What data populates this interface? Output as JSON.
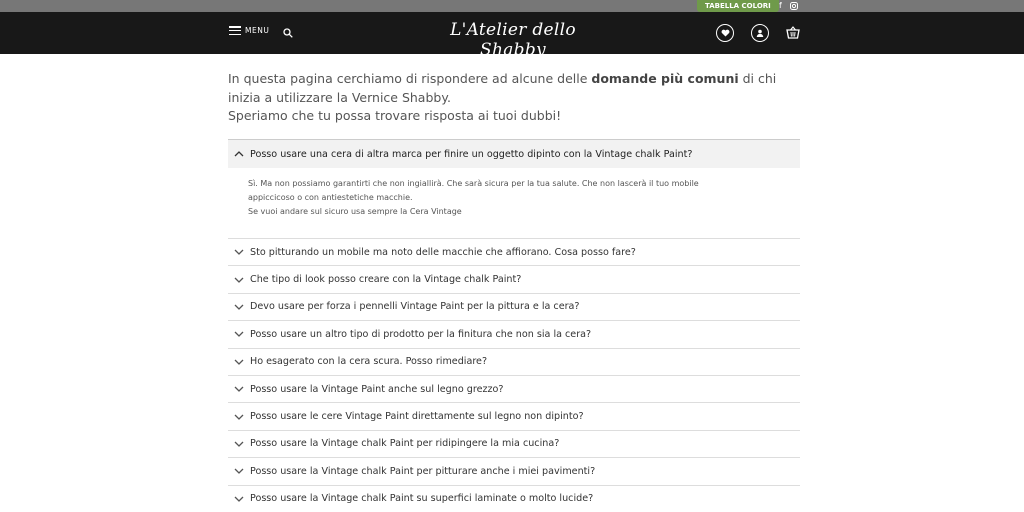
{
  "topbar": {
    "tabella_label": "TABELLA COLORI",
    "facebook_icon": "f"
  },
  "header": {
    "menu_label": "MENU",
    "logo_text": "L'Atelier dello Shabby"
  },
  "intro": {
    "part1": "In questa pagina cerchiamo di rispondere ad alcune delle ",
    "bold": "domande più comuni",
    "part2": " di chi inizia a utilizzare la Vernice Shabby.",
    "line3": "Speriamo che tu possa trovare risposta ai tuoi dubbi!"
  },
  "faq": {
    "open": {
      "question": "Posso usare una cera di altra marca per finire un oggetto dipinto con la Vintage chalk Paint?",
      "answer_line1": "Sì. Ma non possiamo garantirti che non ingiallirà. Che sarà sicura per la tua salute. Che non lascerà il tuo mobile",
      "answer_line2": "appiccicoso o con antiestetiche macchie.",
      "answer_line3": "Se vuoi andare sul sicuro usa sempre la Cera Vintage"
    },
    "items": [
      "Sto pitturando un mobile ma noto delle macchie che affiorano. Cosa posso fare?",
      "Che tipo di look posso creare con la Vintage chalk Paint?",
      "Devo usare per forza i pennelli Vintage Paint per la pittura e la cera?",
      "Posso usare un altro tipo di prodotto per la finitura che non sia la cera?",
      "Ho esagerato con la cera scura. Posso rimediare?",
      "Posso usare la Vintage Paint anche sul legno grezzo?",
      "Posso usare le cere Vintage Paint direttamente sul legno non dipinto?",
      "Posso usare la Vintage chalk Paint per ridipingere la mia cucina?",
      "Posso usare la Vintage chalk Paint per pitturare anche i miei pavimenti?",
      "Posso usare la Vintage chalk Paint su superfici laminate o molto lucide?"
    ]
  },
  "icons": [
    "hamburger-icon",
    "search-icon",
    "heart-icon",
    "user-icon",
    "cart-icon",
    "facebook-icon",
    "instagram-icon",
    "chevron-up-icon",
    "chevron-down-icon"
  ]
}
